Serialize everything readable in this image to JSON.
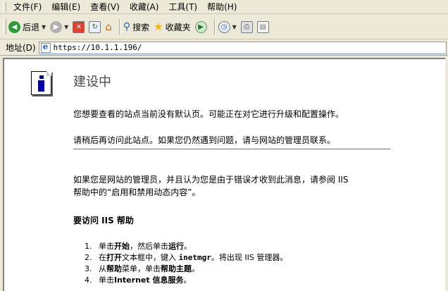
{
  "menu": [
    "文件(F)",
    "编辑(E)",
    "查看(V)",
    "收藏(A)",
    "工具(T)",
    "帮助(H)"
  ],
  "toolbar": {
    "back_label": "后退",
    "search_label": "搜索",
    "favorites_label": "收藏夹"
  },
  "address": {
    "label": "地址(D)",
    "url": "https://10.1.1.196/"
  },
  "page": {
    "title": "建设中",
    "para1": "您想要查看的站点当前没有默认页。可能正在对它进行升级和配置操作。",
    "para2": "请稍后再访问此站点。如果您仍然遇到问题，请与网站的管理员联系。",
    "para3_line1": "如果您是网站的管理员，并且认为您是由于错误才收到此消息，请参阅 IIS",
    "para3_line2": "帮助中的“启用和禁用动态内容”。",
    "help_heading": "要访问 IIS 帮助",
    "steps": [
      {
        "num": "1.",
        "pre": "单击",
        "b1": "开始",
        "mid": "，然后单击",
        "b2": "运行",
        "post": "。"
      },
      {
        "num": "2.",
        "pre": "在",
        "b1": "打开",
        "mid": "文本框中，键入 ",
        "b2": "inetmgr",
        "post": "。将出现 IIS 管理器。"
      },
      {
        "num": "3.",
        "pre": "从",
        "b1": "帮助",
        "mid": "菜单，单击",
        "b2": "帮助主题",
        "post": "。"
      },
      {
        "num": "4.",
        "pre": "单击",
        "b1": "Internet 信息服务",
        "mid": "",
        "b2": "",
        "post": "。"
      }
    ]
  },
  "colors": {
    "divider": "#5c6cc8",
    "icon_blue": "#0000a0"
  }
}
